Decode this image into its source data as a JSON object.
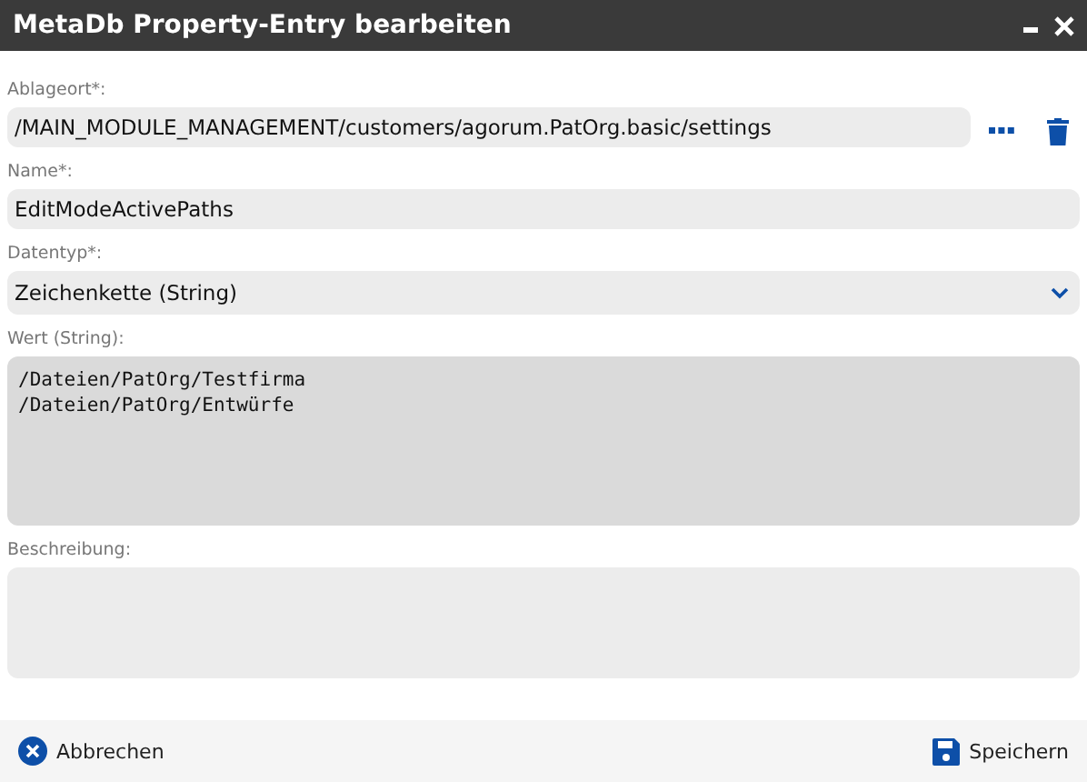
{
  "window": {
    "title": "MetaDb Property-Entry bearbeiten"
  },
  "fields": [
    {
      "kind": "path",
      "label": "Ablageort*:",
      "value": "/MAIN_MODULE_MANAGEMENT/customers/agorum.PatOrg.basic/settings"
    },
    {
      "kind": "text",
      "label": "Name*:",
      "value": "EditModeActivePaths"
    },
    {
      "kind": "select",
      "label": "Datentyp*:",
      "value": "Zeichenkette (String)"
    },
    {
      "kind": "code",
      "label": "Wert (String):",
      "value": "/Dateien/PatOrg/Testfirma\n/Dateien/PatOrg/Entwürfe"
    },
    {
      "kind": "area",
      "label": "Beschreibung:"
    }
  ],
  "buttons": [
    {
      "kind": "cancel",
      "label": "Abbrechen"
    },
    {
      "kind": "save",
      "label": "Speichern"
    }
  ]
}
